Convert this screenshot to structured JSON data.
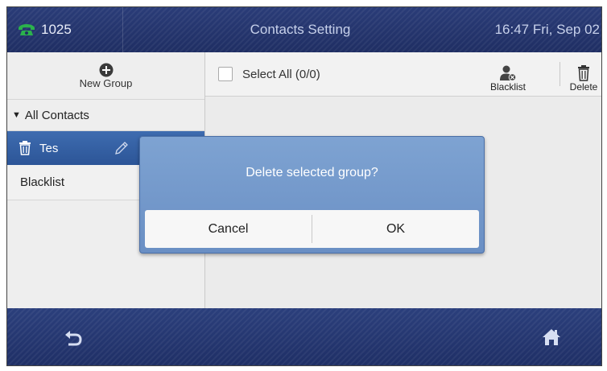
{
  "header": {
    "extension": "1025",
    "title": "Contacts Setting",
    "datetime": "16:47 Fri, Sep 02"
  },
  "left_panel": {
    "new_group_label": "New Group",
    "all_contacts_label": "All Contacts",
    "groups": [
      {
        "label": "Tes",
        "selected": true
      },
      {
        "label": "Blacklist",
        "selected": false
      }
    ]
  },
  "right_panel": {
    "select_all_label": "Select All (0/0)",
    "blacklist_label": "Blacklist",
    "delete_label": "Delete"
  },
  "dialog": {
    "message": "Delete selected group?",
    "cancel_label": "Cancel",
    "ok_label": "OK"
  },
  "footer": {
    "back_icon": "back-arrow-icon",
    "home_icon": "home-icon"
  },
  "colors": {
    "bar": "#24356d",
    "selected_row": "#3a68ab",
    "dialog": "#7398cb",
    "phone_icon": "#2bb24c"
  }
}
